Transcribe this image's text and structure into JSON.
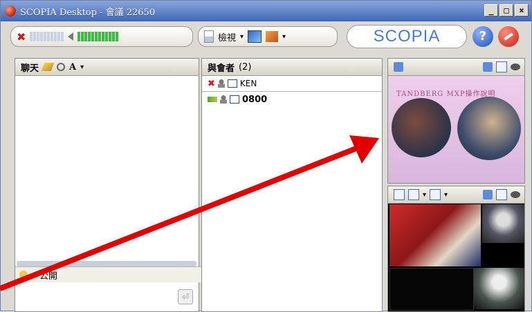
{
  "window": {
    "title": "SCOPIA Desktop - 會議 22650",
    "buttons": [
      "_",
      "□",
      "×"
    ]
  },
  "toolbar": {
    "view_label": "檢視",
    "logo_text": "SCOPIA",
    "help_label": "?"
  },
  "chat": {
    "title": "聊天",
    "font_label": "A",
    "scope_label": "公開",
    "send_symbol": "⏎"
  },
  "participants": {
    "title": "與會者",
    "count": "(2)",
    "list": [
      {
        "name": "KEN",
        "muted": true
      },
      {
        "name": "0800",
        "muted": false
      }
    ]
  },
  "video": {
    "caption": "TANDBERG MXP操作說明"
  },
  "colors": {
    "title_bar": "#3f67b8",
    "accent": "#4b7bd1",
    "arrow": "#e10000"
  }
}
